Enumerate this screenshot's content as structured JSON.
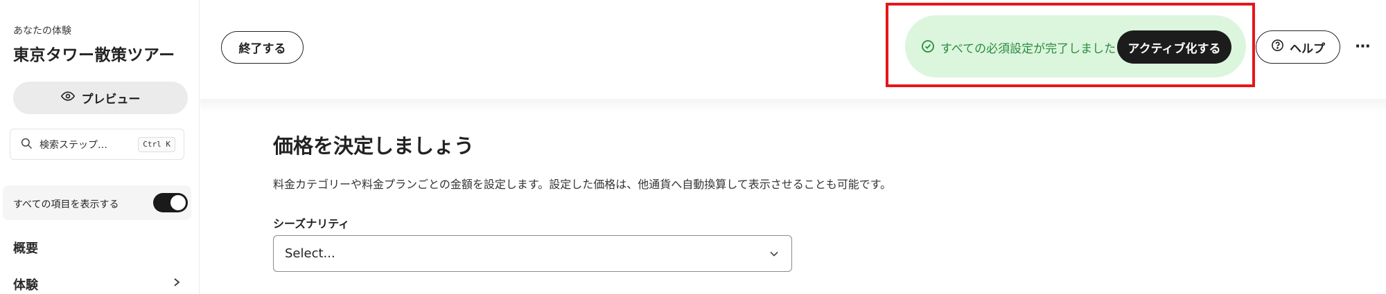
{
  "sidebar": {
    "subtitle": "あなたの体験",
    "title": "東京タワー散策ツアー",
    "preview_label": "プレビュー",
    "search_placeholder": "検索ステップ…",
    "search_shortcut": "Ctrl K",
    "show_all_label": "すべての項目を表示する",
    "show_all_on": true,
    "nav": [
      {
        "label": "概要"
      },
      {
        "label": "体験"
      }
    ]
  },
  "header": {
    "exit_label": "終了する",
    "status_text": "すべての必須設定が完了しました",
    "activate_label": "アクティブ化する",
    "help_label": "ヘルプ",
    "more_label": "⋯"
  },
  "main": {
    "title": "価格を決定しましょう",
    "description": "料金カテゴリーや料金プランごとの金額を設定します。設定した価格は、他通貨へ自動換算して表示させることも可能です。",
    "seasonality_label": "シーズナリティ",
    "seasonality_value": "Select..."
  },
  "colors": {
    "accent_dark": "#1c1c1c",
    "status_green_bg": "#dbf6dd",
    "status_green_text": "#2b8a3e",
    "highlight_red": "#e5161b"
  }
}
